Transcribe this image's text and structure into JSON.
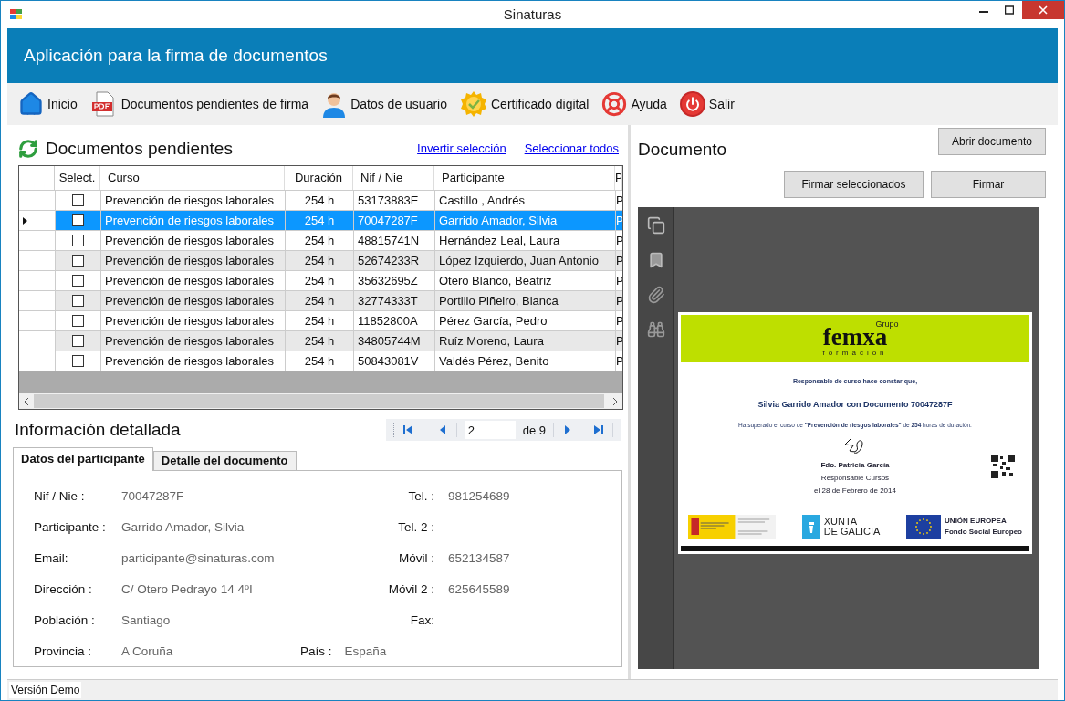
{
  "window": {
    "title": "Sinaturas"
  },
  "header": {
    "title": "Aplicación para la firma de documentos"
  },
  "toolbar": [
    {
      "kind": "home",
      "label": "Inicio"
    },
    {
      "kind": "pdf",
      "label": "Documentos pendientes de firma"
    },
    {
      "kind": "user",
      "label": "Datos de usuario"
    },
    {
      "kind": "certificate",
      "label": "Certificado digital"
    },
    {
      "kind": "help",
      "label": "Ayuda"
    },
    {
      "kind": "exit",
      "label": "Salir"
    }
  ],
  "pending": {
    "title": "Documentos pendientes",
    "links": [
      "Invertir selección",
      "Seleccionar todos"
    ],
    "select_column": "Select.",
    "columns": [
      "Curso",
      "Duración",
      "Nif / Nie",
      "Participante",
      "P"
    ],
    "rows": [
      {
        "checked": false,
        "selected": false,
        "cells": [
          "Prevención de riesgos laborales",
          "254 h",
          "53173883E",
          "Castillo , Andrés",
          "P"
        ]
      },
      {
        "checked": false,
        "selected": true,
        "cells": [
          "Prevención de riesgos laborales",
          "254 h",
          "70047287F",
          "Garrido Amador, Silvia",
          "P"
        ]
      },
      {
        "checked": false,
        "selected": false,
        "cells": [
          "Prevención de riesgos laborales",
          "254 h",
          "48815741N",
          "Hernández Leal, Laura",
          "P"
        ]
      },
      {
        "checked": false,
        "selected": false,
        "cells": [
          "Prevención de riesgos laborales",
          "254 h",
          "52674233R",
          "López Izquierdo, Juan Antonio",
          "P"
        ]
      },
      {
        "checked": false,
        "selected": false,
        "cells": [
          "Prevención de riesgos laborales",
          "254 h",
          "35632695Z",
          "Otero Blanco, Beatriz",
          "P"
        ]
      },
      {
        "checked": false,
        "selected": false,
        "cells": [
          "Prevención de riesgos laborales",
          "254 h",
          "32774333T",
          "Portillo Piñeiro, Blanca",
          "P"
        ]
      },
      {
        "checked": false,
        "selected": false,
        "cells": [
          "Prevención de riesgos laborales",
          "254 h",
          "11852800A",
          "Pérez García, Pedro",
          "P"
        ]
      },
      {
        "checked": false,
        "selected": false,
        "cells": [
          "Prevención de riesgos laborales",
          "254 h",
          "34805744M",
          "Ruíz Moreno, Laura",
          "P"
        ]
      },
      {
        "checked": false,
        "selected": false,
        "cells": [
          "Prevención de riesgos laborales",
          "254 h",
          "50843081V",
          "Valdés Pérez, Benito",
          "P"
        ]
      }
    ]
  },
  "details": {
    "title": "Información detallada",
    "pager": {
      "page": "2",
      "total": "de 9"
    },
    "tabs": [
      {
        "label": "Datos del participante",
        "selected": true
      },
      {
        "label": "Detalle del documento",
        "selected": false
      }
    ],
    "rows": [
      [
        {
          "kind": "left",
          "label": "Nif / Nie :",
          "value": "70047287F"
        },
        {
          "kind": "right",
          "label": "Tel. :",
          "value": "981254689"
        }
      ],
      [
        {
          "kind": "left",
          "label": "Participante :",
          "value": "Garrido Amador, Silvia"
        },
        {
          "kind": "right",
          "label": "Tel. 2 :"
        }
      ],
      [
        {
          "kind": "left",
          "label": "Email:",
          "value": "participante@sinaturas.com"
        },
        {
          "kind": "right",
          "label": "Móvil :",
          "value": "652134587"
        }
      ],
      [
        {
          "kind": "left",
          "label": "Dirección :",
          "value": "C/ Otero Pedrayo 14 4ºI"
        },
        {
          "kind": "right",
          "label": "Móvil 2 :",
          "value": "625645589"
        }
      ],
      [
        {
          "kind": "left",
          "label": "Población :",
          "value": "Santiago"
        },
        {
          "kind": "right",
          "label": "Fax:"
        }
      ],
      [
        {
          "kind": "left",
          "label": "Provincia :",
          "value": "A Coruña"
        },
        {
          "kind": "middle",
          "label": "País :",
          "value": "España"
        }
      ]
    ]
  },
  "document": {
    "title": "Documento",
    "buttons": [
      "Abrir documento",
      "Firmar seleccionados",
      "Firmar"
    ],
    "certificate": {
      "logo_top": "Grupo",
      "logo_main": "femxa",
      "logo_sub": "formación",
      "lines": [
        "Responsable de curso hace constar que,",
        "Silvia Garrido Amador con Documento 70047287F",
        "Ha superado el curso de **\"Prevención de riesgos laborales\"** de **254** horas de duración."
      ],
      "signer": "Fdo. Patricia García",
      "role": "Responsable Cursos",
      "date": "el 28 de Febrero de 2014",
      "xunta": [
        "XUNTA",
        "DE GALICIA"
      ],
      "eu": [
        "UNIÓN EUROPEA",
        "Fondo Social Europeo"
      ]
    }
  },
  "status_bar": {
    "text": "Versión Demo"
  }
}
